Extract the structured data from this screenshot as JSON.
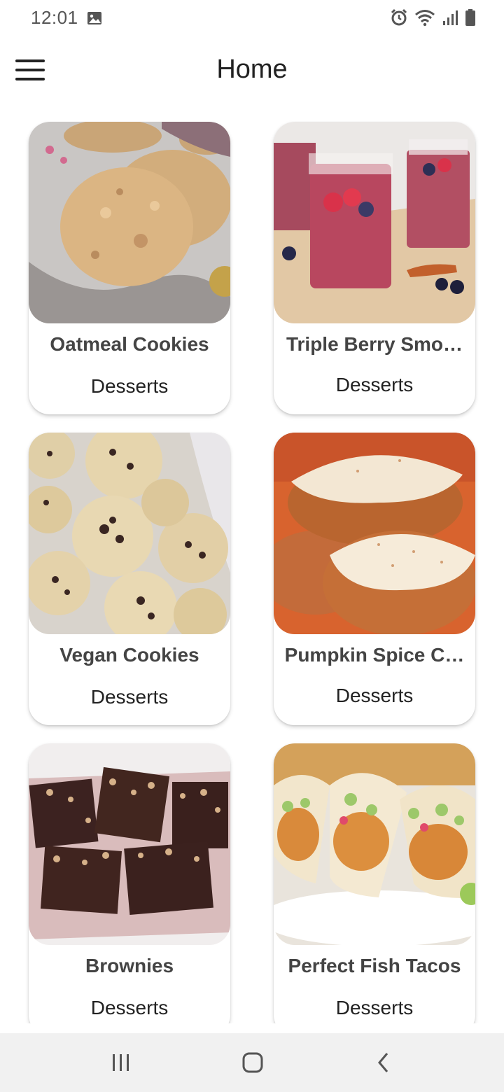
{
  "status_bar": {
    "time": "12:01",
    "icons": [
      "image-icon",
      "alarm-icon",
      "wifi-icon",
      "signal-icon",
      "battery-icon"
    ]
  },
  "app_bar": {
    "title": "Home",
    "menu_icon": "hamburger-menu-icon"
  },
  "recipes": [
    {
      "title": "Oatmeal Cookies",
      "category": "Desserts",
      "image": "oatmeal-cookies-photo"
    },
    {
      "title": "Triple Berry Smo…",
      "category": "Desserts",
      "image": "triple-berry-smoothie-photo"
    },
    {
      "title": "Vegan Cookies",
      "category": "Desserts",
      "image": "vegan-cookies-photo"
    },
    {
      "title": "Pumpkin Spice C…",
      "category": "Desserts",
      "image": "pumpkin-spice-cookies-photo"
    },
    {
      "title": "Brownies",
      "category": "Desserts",
      "image": "brownies-photo"
    },
    {
      "title": "Perfect Fish Tacos",
      "category": "Desserts",
      "image": "fish-tacos-photo"
    }
  ],
  "nav_bar": {
    "icons": [
      "recent-apps-icon",
      "home-icon",
      "back-icon"
    ]
  }
}
